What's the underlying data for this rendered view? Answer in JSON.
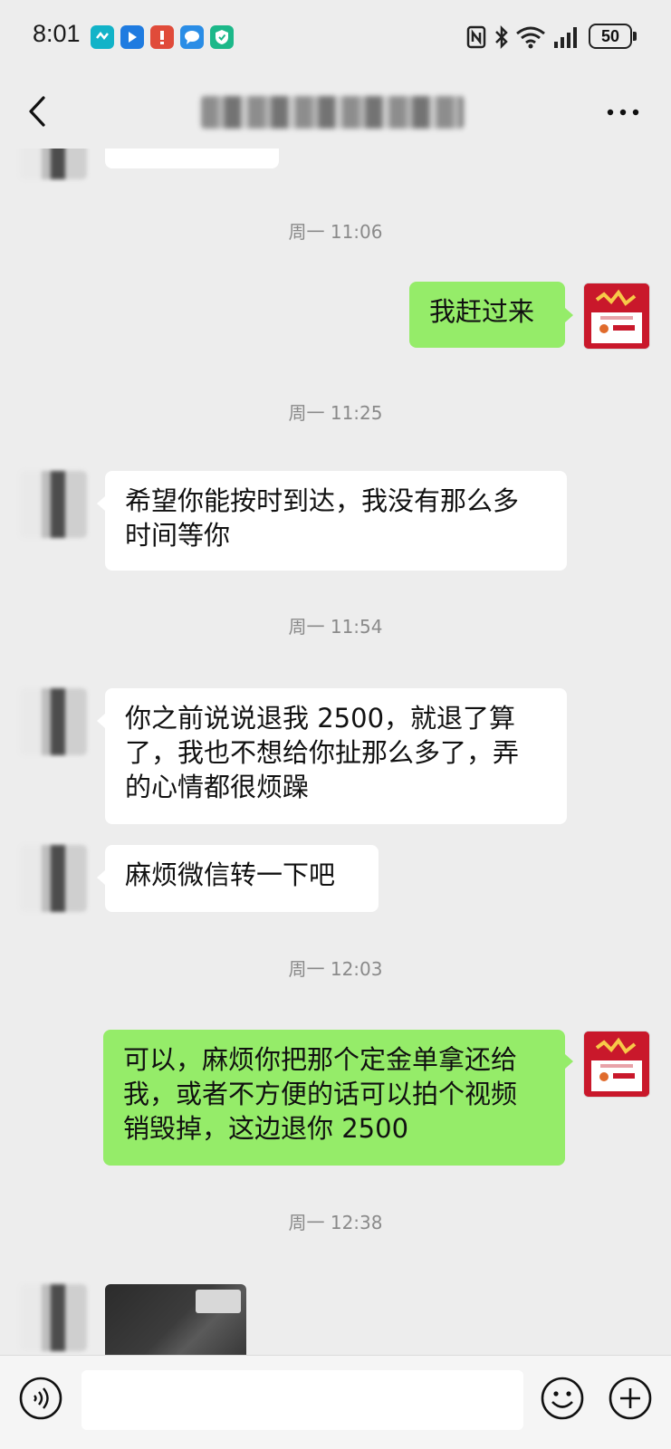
{
  "status_bar": {
    "time": "8:01",
    "battery": "50",
    "app_icons": [
      "app-icon-1",
      "app-icon-2",
      "app-icon-3",
      "app-icon-4",
      "app-icon-5"
    ],
    "system_icons": [
      "nfc-icon",
      "bluetooth-icon",
      "wifi-icon",
      "signal-icon",
      "battery-icon"
    ]
  },
  "header": {
    "title": "",
    "back_icon": "chevron-left-icon",
    "more_icon": "more-icon"
  },
  "messages": [
    {
      "type": "timestamp",
      "text": "周一 11:06"
    },
    {
      "type": "text",
      "direction": "out",
      "text": "我赶过来"
    },
    {
      "type": "timestamp",
      "text": "周一 11:25"
    },
    {
      "type": "text",
      "direction": "in",
      "lines": [
        "希望你能按时到达，我没有那么多",
        "时间等你"
      ]
    },
    {
      "type": "timestamp",
      "text": "周一 11:54"
    },
    {
      "type": "text",
      "direction": "in",
      "lines": [
        "你之前说说退我 2500，就退了算",
        "了，我也不想给你扯那么多了，弄",
        "的心情都很烦躁"
      ]
    },
    {
      "type": "text",
      "direction": "in",
      "text": "麻烦微信转一下吧"
    },
    {
      "type": "timestamp",
      "text": "周一 12:03"
    },
    {
      "type": "text",
      "direction": "out",
      "lines": [
        "可以，麻烦你把那个定金单拿还给",
        "我，或者不方便的话可以拍个视频",
        "销毁掉，这边退你 2500"
      ]
    },
    {
      "type": "timestamp",
      "text": "周一 12:38"
    },
    {
      "type": "image",
      "direction": "in"
    }
  ],
  "input_bar": {
    "placeholder": "",
    "voice_icon": "voice-icon",
    "emoji_icon": "emoji-icon",
    "plus_icon": "plus-icon"
  },
  "colors": {
    "background": "#ededed",
    "bubble_out": "#95ec69",
    "bubble_in": "#ffffff",
    "timestamp": "#8a8a8a"
  }
}
